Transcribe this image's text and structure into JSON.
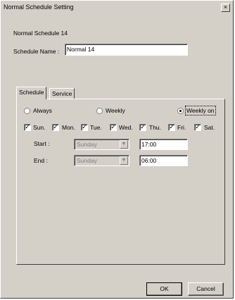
{
  "window": {
    "title": "Normal Schedule Setting",
    "close_glyph": "×"
  },
  "header": {
    "schedule_id_label": "Normal Schedule 14",
    "schedule_name_label": "Schedule Name :",
    "schedule_name_value": "Normal 14"
  },
  "tabs": [
    {
      "label": "Schedule",
      "active": true
    },
    {
      "label": "Service",
      "active": false
    }
  ],
  "schedule": {
    "modes": [
      {
        "label": "Always",
        "checked": false
      },
      {
        "label": "Weekly",
        "checked": false
      },
      {
        "label": "Weekly on",
        "checked": true
      }
    ],
    "days": [
      {
        "label": "Sun.",
        "checked": true
      },
      {
        "label": "Mon.",
        "checked": true
      },
      {
        "label": "Tue.",
        "checked": true
      },
      {
        "label": "Wed.",
        "checked": true
      },
      {
        "label": "Thu.",
        "checked": true
      },
      {
        "label": "Fri.",
        "checked": true
      },
      {
        "label": "Sat.",
        "checked": true
      }
    ],
    "start": {
      "label": "Start :",
      "day": "Sunday",
      "time": "17:00"
    },
    "end": {
      "label": "End :",
      "day": "Sunday",
      "time": "06:00"
    }
  },
  "buttons": {
    "ok": "OK",
    "cancel": "Cancel"
  },
  "icons": {
    "check_glyph": "✓",
    "dropdown_glyph": "▼"
  },
  "colors": {
    "dialog_face": "#d4d0c8",
    "disabled_text": "#808080"
  }
}
